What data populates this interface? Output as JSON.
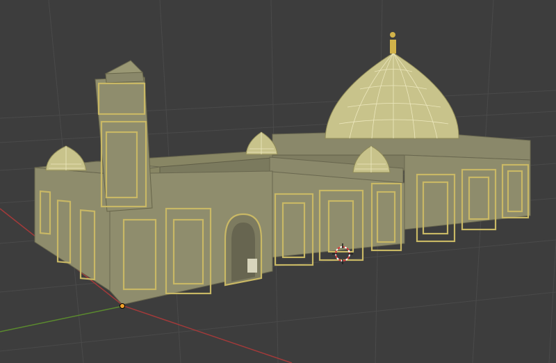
{
  "app": {
    "view_type": "3D Viewport",
    "shading": "solid",
    "overlay_text": ""
  },
  "scene": {
    "object": "mosque model",
    "colors": {
      "background": "#3d3d3d",
      "grid": "#4a4a4a",
      "x_axis": "#a33a3a",
      "y_axis": "#5b8a2e",
      "wall": "#8e8c6c",
      "wall_dark": "#6f6d52",
      "trim": "#c9b865",
      "dome": "#c8c38b",
      "dome_wire": "#e6e2b8",
      "roof": "#8a886a"
    }
  }
}
